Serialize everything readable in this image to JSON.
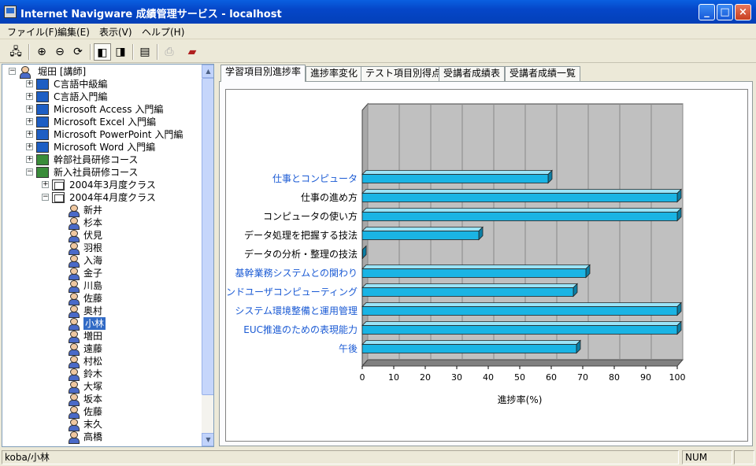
{
  "window": {
    "title": "Internet Navigware 成績管理サービス - localhost",
    "buttons": {
      "minimize": "_",
      "maximize": "□",
      "close": "×"
    }
  },
  "menu": [
    "ファイル(F)",
    "編集(E)",
    "表示(V)",
    "ヘルプ(H)"
  ],
  "tree": {
    "root": "堀田 [講師]",
    "courses": [
      "C言語中級編",
      "C言語入門編",
      "Microsoft Access 入門編",
      "Microsoft Excel 入門編",
      "Microsoft PowerPoint 入門編",
      "Microsoft Word 入門編",
      "幹部社員研修コース",
      "新入社員研修コース"
    ],
    "classes": [
      "2004年3月度クラス",
      "2004年4月度クラス"
    ],
    "students": [
      "新井",
      "杉本",
      "伏見",
      "羽根",
      "入海",
      "金子",
      "川島",
      "佐藤",
      "奥村",
      "小林",
      "増田",
      "遠藤",
      "村松",
      "鈴木",
      "大塚",
      "坂本",
      "佐藤",
      "末久",
      "高橋"
    ],
    "selected_student": "小林"
  },
  "tabs": [
    "学習項目別進捗率",
    "進捗率変化",
    "テスト項目別得点",
    "受講者成績表",
    "受講者成績一覧"
  ],
  "active_tab": 0,
  "chart_data": {
    "type": "bar",
    "orientation": "horizontal",
    "categories": [
      "仕事とコンピュータ",
      "仕事の進め方",
      "コンピュータの使い方",
      "データ処理を把握する技法",
      "データの分析・整理の技法",
      "基幹業務システムとの関わり",
      "エンドユーザコンピューティング",
      "システム環境整備と運用管理",
      "EUC推進のための表現能力",
      "午後"
    ],
    "link_categories": [
      true,
      false,
      false,
      false,
      false,
      true,
      true,
      true,
      true,
      true
    ],
    "values": [
      59,
      100,
      100,
      37,
      0,
      71,
      67,
      100,
      100,
      68
    ],
    "xlabel": "進捗率(%)",
    "xlim": [
      0,
      100
    ],
    "xticks": [
      0,
      10,
      20,
      30,
      40,
      50,
      60,
      70,
      80,
      90,
      100
    ],
    "grid": true,
    "bar_color": "#1ab4e4",
    "link_color": "#1a5ad4"
  },
  "status": {
    "path": "koba/小林",
    "num": "NUM"
  }
}
